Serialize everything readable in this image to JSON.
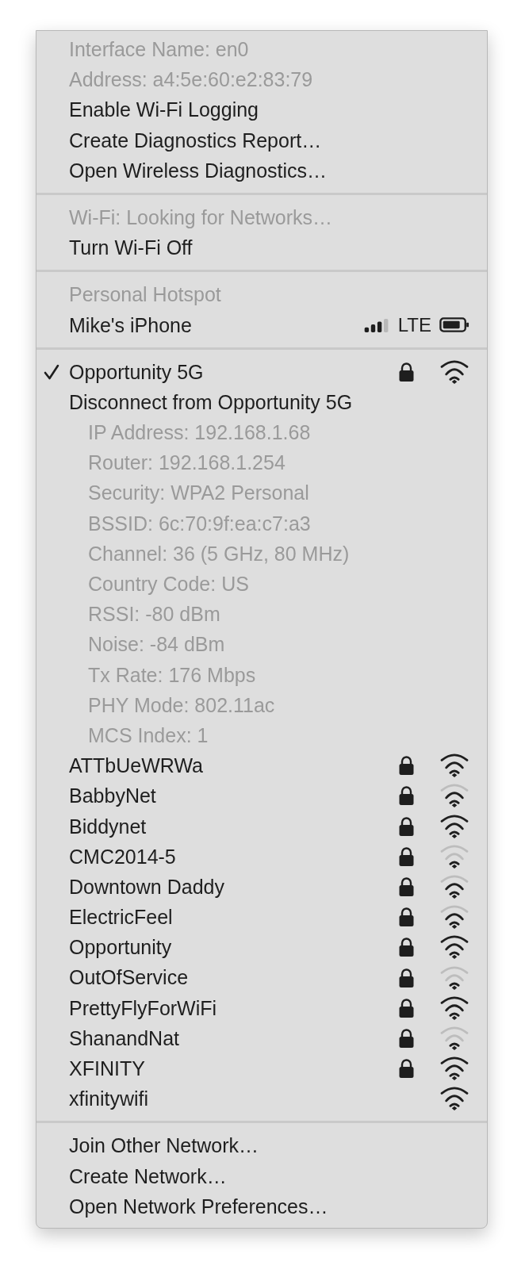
{
  "sections": [
    {
      "items": [
        {
          "kind": "item",
          "label": "Interface Name: en0",
          "disabled": true
        },
        {
          "kind": "item",
          "label": "Address: a4:5e:60:e2:83:79",
          "disabled": true
        },
        {
          "kind": "item",
          "label": "Enable Wi-Fi Logging",
          "disabled": false
        },
        {
          "kind": "item",
          "label": "Create Diagnostics Report…",
          "disabled": false
        },
        {
          "kind": "item",
          "label": "Open Wireless Diagnostics…",
          "disabled": false
        }
      ]
    },
    {
      "items": [
        {
          "kind": "item",
          "label": "Wi-Fi: Looking for Networks…",
          "disabled": true
        },
        {
          "kind": "item",
          "label": "Turn Wi-Fi Off",
          "disabled": false
        }
      ]
    },
    {
      "items": [
        {
          "kind": "item",
          "label": "Personal Hotspot",
          "disabled": true
        },
        {
          "kind": "hotspot",
          "label": "Mike's iPhone",
          "carrier": "LTE"
        }
      ]
    },
    {
      "items": [
        {
          "kind": "network",
          "label": "Opportunity 5G",
          "selected": true,
          "locked": true,
          "signal_fair": true,
          "signal_strong": true
        },
        {
          "kind": "item",
          "label": "Disconnect from Opportunity 5G",
          "disabled": false
        },
        {
          "kind": "details",
          "lines": [
            "IP Address: 192.168.1.68",
            "Router: 192.168.1.254",
            "Security: WPA2 Personal",
            "BSSID: 6c:70:9f:ea:c7:a3",
            "Channel: 36 (5 GHz, 80 MHz)",
            "Country Code: US",
            "RSSI: -80 dBm",
            "Noise: -84 dBm",
            "Tx Rate: 176 Mbps",
            "PHY Mode: 802.11ac",
            "MCS Index: 1"
          ]
        },
        {
          "kind": "network",
          "label": "ATTbUeWRWa",
          "selected": false,
          "locked": true,
          "signal_fair": true,
          "signal_strong": true
        },
        {
          "kind": "network",
          "label": "BabbyNet",
          "selected": false,
          "locked": true,
          "signal_fair": true,
          "signal_strong": false
        },
        {
          "kind": "network",
          "label": "Biddynet",
          "selected": false,
          "locked": true,
          "signal_fair": true,
          "signal_strong": true
        },
        {
          "kind": "network",
          "label": "CMC2014-5",
          "selected": false,
          "locked": true,
          "signal_fair": false,
          "signal_strong": false
        },
        {
          "kind": "network",
          "label": "Downtown Daddy",
          "selected": false,
          "locked": true,
          "signal_fair": true,
          "signal_strong": false
        },
        {
          "kind": "network",
          "label": "ElectricFeel",
          "selected": false,
          "locked": true,
          "signal_fair": true,
          "signal_strong": false
        },
        {
          "kind": "network",
          "label": "Opportunity",
          "selected": false,
          "locked": true,
          "signal_fair": true,
          "signal_strong": true
        },
        {
          "kind": "network",
          "label": "OutOfService",
          "selected": false,
          "locked": true,
          "signal_fair": false,
          "signal_strong": false
        },
        {
          "kind": "network",
          "label": "PrettyFlyForWiFi",
          "selected": false,
          "locked": true,
          "signal_fair": true,
          "signal_strong": true
        },
        {
          "kind": "network",
          "label": "ShanandNat",
          "selected": false,
          "locked": true,
          "signal_fair": false,
          "signal_strong": false
        },
        {
          "kind": "network",
          "label": "XFINITY",
          "selected": false,
          "locked": true,
          "signal_fair": true,
          "signal_strong": true
        },
        {
          "kind": "network",
          "label": "xfinitywifi",
          "selected": false,
          "locked": false,
          "signal_fair": true,
          "signal_strong": true
        }
      ]
    },
    {
      "items": [
        {
          "kind": "item",
          "label": "Join Other Network…",
          "disabled": false
        },
        {
          "kind": "item",
          "label": "Create Network…",
          "disabled": false
        },
        {
          "kind": "item",
          "label": "Open Network Preferences…",
          "disabled": false
        }
      ]
    }
  ]
}
